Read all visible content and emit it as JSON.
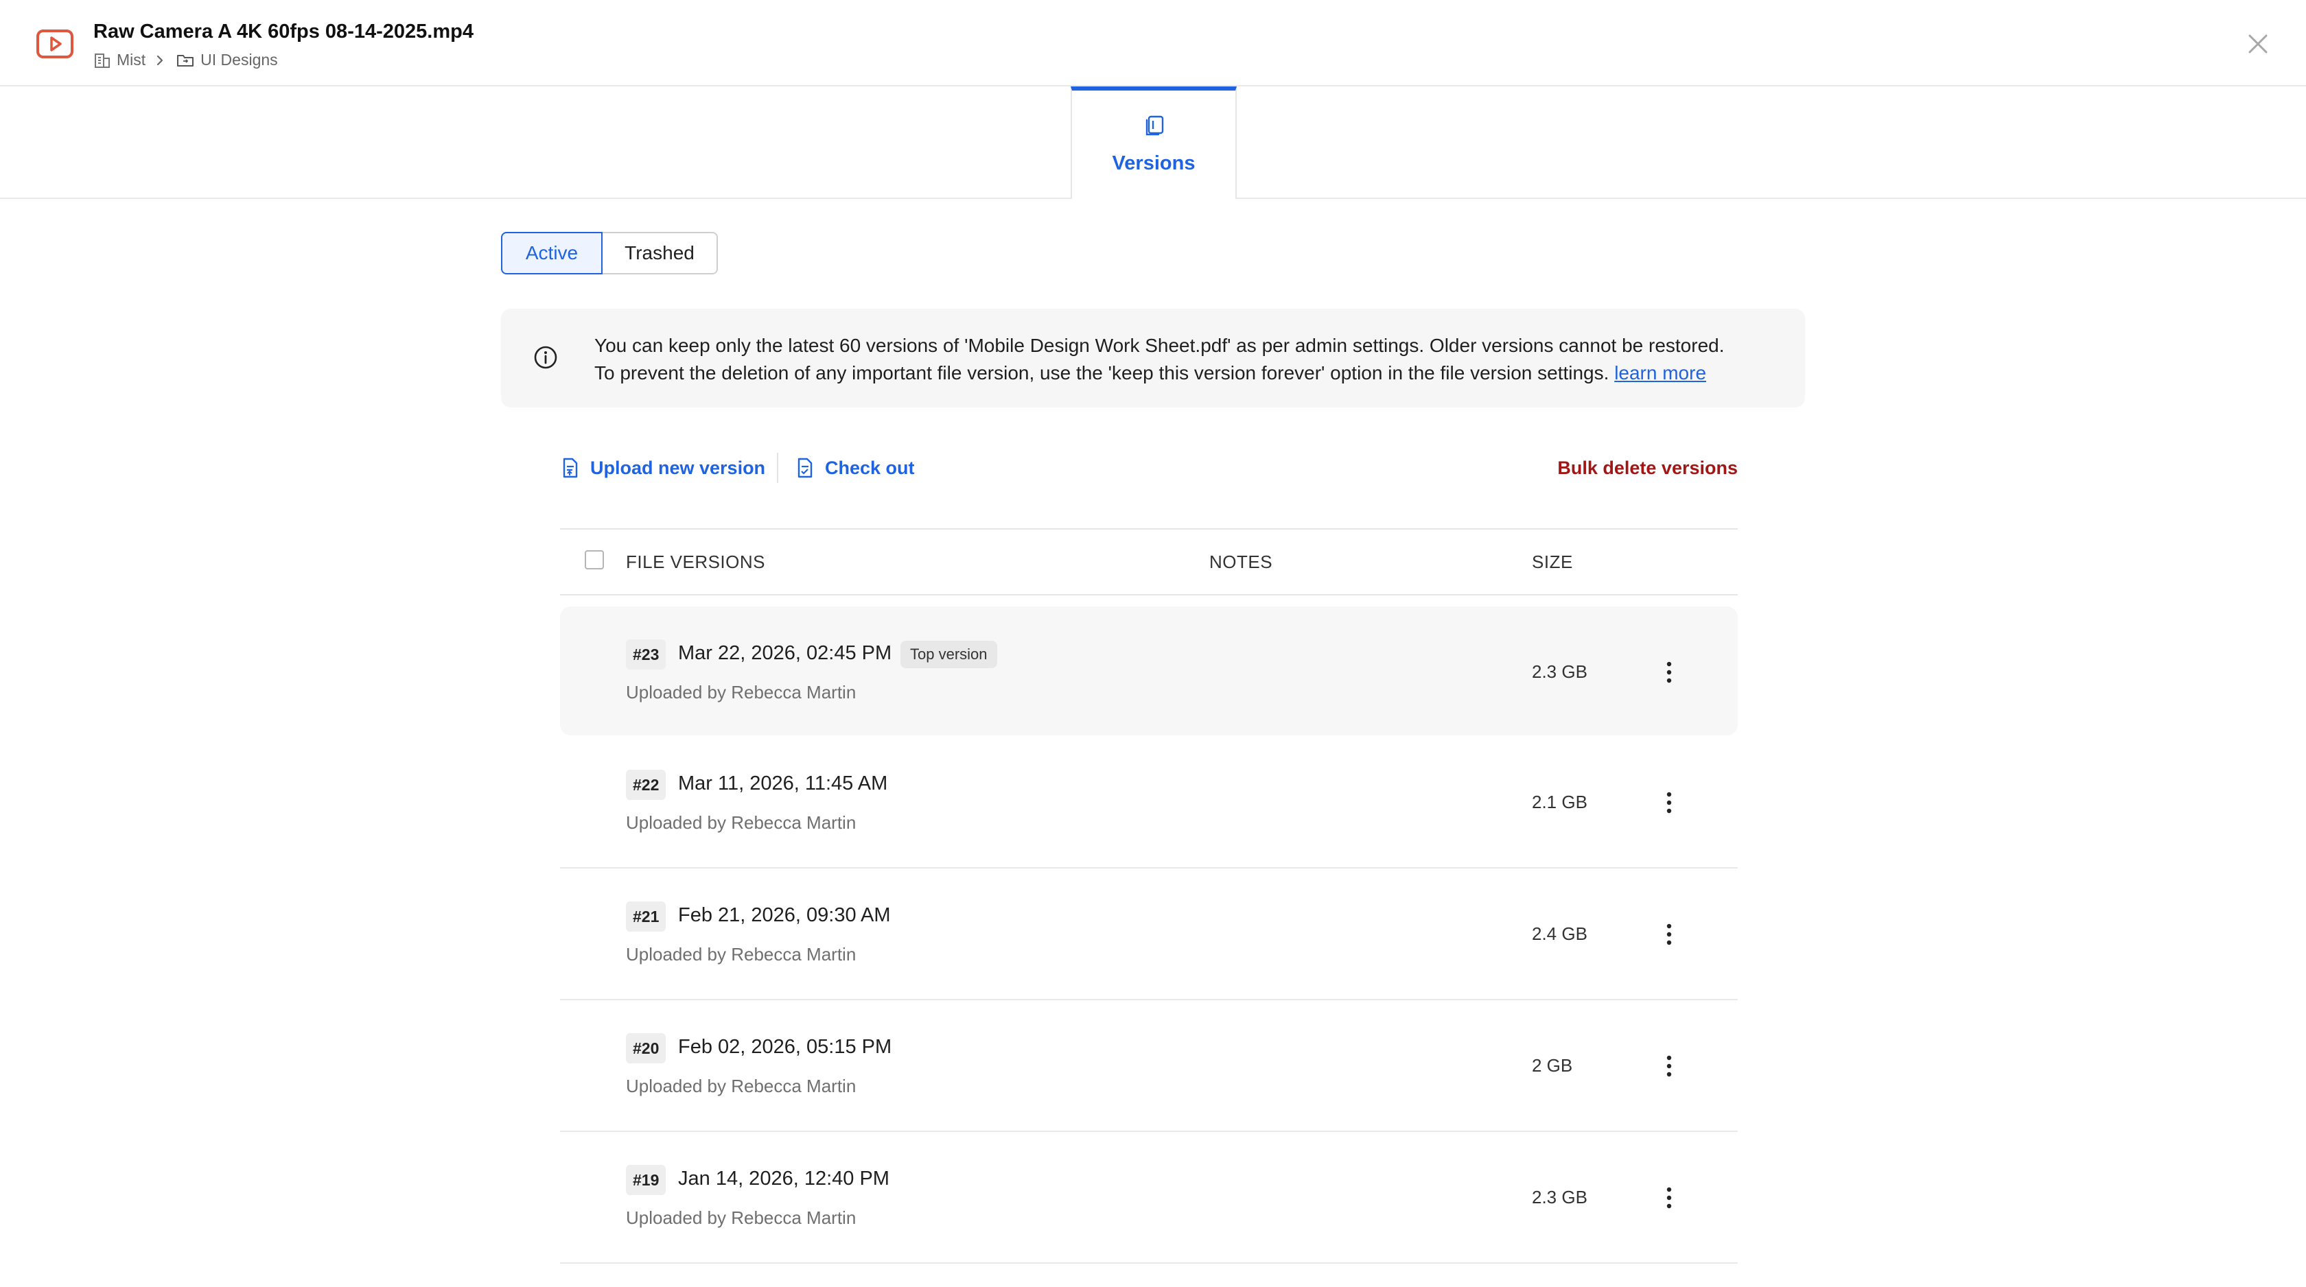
{
  "header": {
    "title": "Raw Camera A 4K 60fps 08-14-2025.mp4",
    "breadcrumb": [
      {
        "label": "Mist",
        "icon": "building-icon"
      },
      {
        "label": "UI Designs",
        "icon": "folder-icon"
      }
    ]
  },
  "tabs": [
    {
      "label": "Versions",
      "icon": "versions-icon",
      "active": true
    }
  ],
  "filter": {
    "active_label": "Active",
    "trashed_label": "Trashed",
    "selected": "Active"
  },
  "notice": {
    "line1": "You can keep only the latest 60 versions of 'Mobile Design Work Sheet.pdf' as per admin settings. Older versions cannot be restored.",
    "line2": "To prevent the deletion of any important file version, use the 'keep this version forever' option in the file version settings.",
    "link": "learn more"
  },
  "actions": {
    "upload": "Upload new version",
    "checkout": "Check out",
    "bulk_delete": "Bulk delete versions"
  },
  "table": {
    "columns": [
      "FILE VERSIONS",
      "NOTES",
      "SIZE"
    ],
    "rows": [
      {
        "num": "#23",
        "date": "Mar 22, 2026, 02:45 PM",
        "tag": "Top version",
        "uploader": "Uploaded by Rebecca Martin",
        "size": "2.3 GB"
      },
      {
        "num": "#22",
        "date": "Mar 11, 2026, 11:45 AM",
        "uploader": "Uploaded by Rebecca Martin",
        "size": "2.1 GB"
      },
      {
        "num": "#21",
        "date": "Feb 21, 2026, 09:30 AM",
        "uploader": "Uploaded by Rebecca Martin",
        "size": "2.4 GB"
      },
      {
        "num": "#20",
        "date": "Feb 02, 2026, 05:15 PM",
        "uploader": "Uploaded by Rebecca Martin",
        "size": "2 GB"
      },
      {
        "num": "#19",
        "date": "Jan 14, 2026, 12:40 PM",
        "uploader": "Uploaded by Rebecca Martin",
        "size": "2.3 GB"
      }
    ]
  },
  "colors": {
    "accent": "#1f63e0",
    "danger": "#a31616",
    "file_icon": "#e0573f"
  }
}
